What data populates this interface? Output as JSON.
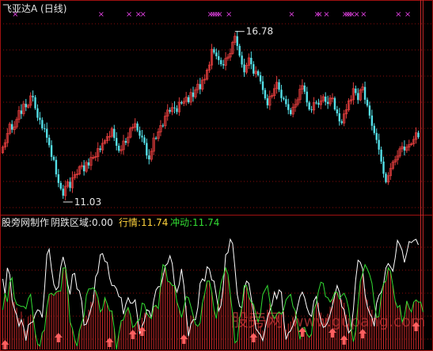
{
  "header": {
    "title": "飞亚达A (日线)",
    "high_label": "16.78",
    "low_label": "11.03"
  },
  "indicator_bar": {
    "maker": "股旁网制作",
    "yin_label": "阴跌区域:0.00",
    "hang_label": "行情:11.74",
    "chong_label": "冲动:11.74"
  },
  "watermark": {
    "cn": "股旁网",
    "en": "www.gupang.com"
  },
  "colors": {
    "background": "#000000",
    "up_candle": "#e03c3c",
    "down_candle": "#54e0e8",
    "grid": "#8a0b0b",
    "frame": "#a01010",
    "indicator_white": "#ffffff",
    "indicator_green": "#33dd33",
    "histogram": "#cc2b2b",
    "signal_arrow": "#ff6060",
    "marker": "#e040e0",
    "label_yellow": "#ffd23c",
    "label_green": "#33dd33"
  },
  "chart_data": [
    {
      "type": "candlestick",
      "title": "飞亚达A (日线)",
      "x": [
        1,
        2,
        3,
        4,
        5,
        6,
        7,
        8,
        9,
        10,
        11,
        12,
        13,
        14,
        15,
        16,
        17,
        18,
        19,
        20,
        21,
        22,
        23,
        24,
        25,
        26,
        27,
        28,
        29,
        30,
        31,
        32,
        33,
        34,
        35,
        36,
        37,
        38,
        39,
        40,
        41,
        42,
        43,
        44,
        45,
        46,
        47,
        48,
        49,
        50,
        51,
        52,
        53,
        54,
        55,
        56,
        57,
        58,
        59,
        60,
        61,
        62,
        63,
        64,
        65,
        66,
        67,
        68,
        69,
        70,
        71,
        72,
        73,
        74,
        75,
        76,
        77,
        78,
        79,
        80,
        81,
        82,
        83,
        84,
        85,
        86,
        87,
        88,
        89,
        90,
        91,
        92,
        93,
        94,
        95,
        96,
        97,
        98,
        99,
        100,
        101,
        102,
        103,
        104,
        105,
        106,
        107,
        108,
        109,
        110,
        111,
        112,
        113,
        114,
        115,
        116,
        117,
        118,
        119,
        120,
        121,
        122,
        123,
        124,
        125,
        126,
        127,
        128,
        129,
        130,
        131,
        132,
        133,
        134,
        135,
        136,
        137,
        138,
        139,
        140,
        141,
        142,
        143,
        144,
        145,
        146,
        147,
        148,
        149,
        150,
        151,
        152,
        153,
        154,
        155,
        156,
        157,
        158,
        159,
        160,
        161,
        162,
        163,
        164,
        165,
        166,
        167,
        168,
        169,
        170,
        171,
        172,
        173,
        174,
        175,
        176,
        177,
        178,
        179,
        180
      ],
      "close": [
        12.78,
        12.94,
        13.27,
        13.61,
        13.41,
        13.51,
        13.78,
        14.1,
        13.98,
        14.34,
        14.22,
        14.29,
        14.63,
        14.58,
        14.18,
        13.84,
        13.76,
        13.46,
        13.44,
        13.12,
        12.85,
        12.43,
        12.32,
        11.8,
        11.49,
        11.28,
        11.03,
        11.37,
        11.53,
        11.31,
        11.68,
        11.79,
        11.81,
        12.07,
        12.12,
        11.91,
        12.23,
        12.12,
        12.41,
        12.41,
        12.44,
        12.73,
        12.68,
        12.92,
        13.01,
        13.16,
        13.17,
        13.44,
        13.11,
        12.83,
        12.65,
        12.69,
        13.0,
        12.94,
        13.14,
        13.46,
        13.5,
        13.63,
        13.38,
        13.19,
        13.13,
        12.93,
        12.48,
        12.34,
        12.63,
        13.11,
        13.09,
        13.33,
        13.56,
        13.55,
        13.9,
        14.12,
        14.06,
        14.21,
        14.18,
        14.05,
        14.4,
        14.36,
        14.43,
        14.58,
        14.4,
        14.75,
        14.59,
        14.85,
        15.05,
        14.87,
        15.2,
        15.23,
        15.56,
        15.74,
        16.31,
        16.19,
        16.06,
        15.92,
        15.77,
        15.73,
        15.98,
        16.03,
        16.16,
        16.56,
        16.78,
        16.43,
        16.08,
        15.76,
        15.48,
        15.73,
        16.0,
        15.77,
        15.43,
        15.52,
        15.37,
        15.15,
        14.84,
        14.54,
        14.29,
        14.61,
        14.64,
        14.89,
        15.12,
        14.85,
        14.55,
        14.51,
        14.33,
        14.12,
        13.97,
        14.22,
        14.32,
        14.49,
        14.87,
        15.0,
        14.78,
        14.39,
        14.14,
        14.12,
        14.39,
        14.38,
        14.31,
        14.45,
        14.6,
        14.41,
        14.34,
        14.55,
        14.55,
        14.14,
        14.0,
        13.71,
        13.65,
        13.98,
        14.13,
        14.45,
        14.49,
        14.89,
        14.73,
        14.48,
        14.84,
        14.95,
        14.49,
        14.28,
        13.92,
        13.55,
        13.29,
        13.04,
        12.69,
        12.26,
        11.82,
        11.52,
        11.75,
        12.01,
        12.24,
        12.32,
        12.46,
        12.72,
        12.8,
        12.66,
        12.78,
        12.87,
        12.9,
        13.06,
        13.3,
        13.14
      ],
      "ylim": [
        10.6,
        17.4
      ],
      "annotations": [
        {
          "text": "16.78",
          "x": 101,
          "y": 16.78
        },
        {
          "text": "11.03",
          "x": 27,
          "y": 11.03
        }
      ],
      "marker_x": [
        6,
        43,
        55,
        59,
        61,
        90,
        91,
        92,
        93,
        94,
        98,
        125,
        136,
        137,
        140,
        148,
        149,
        150,
        151,
        153,
        156,
        171,
        175
      ],
      "grid": true,
      "legend": "none"
    },
    {
      "type": "line",
      "title": "",
      "series": [
        {
          "name": "行情",
          "color": "#ffffff",
          "values": [
            0.64,
            0.5,
            0.74,
            0.68,
            0.45,
            0.37,
            0.31,
            0.21,
            0.27,
            0.2,
            0.08,
            0.22,
            0.24,
            0.25,
            0.32,
            0.36,
            0.35,
            0.29,
            0.55,
            0.86,
            0.91,
            0.73,
            0.59,
            0.54,
            0.57,
            0.75,
            0.84,
            0.75,
            0.59,
            0.5,
            0.68,
            0.69,
            0.55,
            0.53,
            0.44,
            0.22,
            0.23,
            0.29,
            0.37,
            0.44,
            0.66,
            0.7,
            0.86,
            0.87,
            0.8,
            0.79,
            0.65,
            0.58,
            0.58,
            0.55,
            0.48,
            0.47,
            0.32,
            0.41,
            0.47,
            0.42,
            0.42,
            0.45,
            0.3,
            0.14,
            0.21,
            0.26,
            0.36,
            0.35,
            0.29,
            0.44,
            0.54,
            0.57,
            0.57,
            0.66,
            0.76,
            0.78,
            0.85,
            0.78,
            0.59,
            0.52,
            0.59,
            0.73,
            0.58,
            0.33,
            0.12,
            0.23,
            0.27,
            0.27,
            0.38,
            0.6,
            0.64,
            0.62,
            0.75,
            0.73,
            0.63,
            0.62,
            0.49,
            0.35,
            0.4,
            0.58,
            0.86,
            0.88,
            1.0,
            0.96,
            0.74,
            0.5,
            0.39,
            0.38,
            0.55,
            0.62,
            0.6,
            0.47,
            0.34,
            0.19,
            0.16,
            0.13,
            0.08,
            0.19,
            0.29,
            0.35,
            0.41,
            0.52,
            0.46,
            0.54,
            0.52,
            0.27,
            0.09,
            0.15,
            0.17,
            0.22,
            0.28,
            0.39,
            0.48,
            0.52,
            0.47,
            0.38,
            0.32,
            0.3,
            0.44,
            0.48,
            0.36,
            0.26,
            0.2,
            0.21,
            0.25,
            0.32,
            0.4,
            0.49,
            0.58,
            0.52,
            0.39,
            0.36,
            0.24,
            0.15,
            0.18,
            0.36,
            0.63,
            0.81,
            0.79,
            0.73,
            0.5,
            0.39,
            0.33,
            0.29,
            0.21,
            0.42,
            0.49,
            0.52,
            0.59,
            0.74,
            0.78,
            0.75,
            0.71,
            0.83,
            0.99,
            0.95,
            0.9,
            0.79,
            0.88,
            0.98,
            0.97,
            0.99,
            1.0,
            0.95
          ]
        },
        {
          "name": "冲动",
          "color": "#33dd33",
          "values": [
            0.36,
            0.51,
            0.43,
            0.61,
            0.65,
            0.47,
            0.41,
            0.4,
            0.39,
            0.39,
            0.37,
            0.46,
            0.5,
            0.32,
            0.15,
            0.05,
            0.03,
            0.15,
            0.18,
            0.38,
            0.5,
            0.51,
            0.49,
            0.52,
            0.53,
            0.53,
            0.74,
            0.74,
            0.54,
            0.25,
            0.19,
            0.09,
            0.03,
            0.17,
            0.24,
            0.3,
            0.49,
            0.55,
            0.55,
            0.56,
            0.53,
            0.47,
            0.34,
            0.37,
            0.47,
            0.41,
            0.35,
            0.35,
            0.19,
            0.0,
            0.14,
            0.26,
            0.27,
            0.34,
            0.38,
            0.31,
            0.2,
            0.22,
            0.26,
            0.27,
            0.42,
            0.41,
            0.33,
            0.3,
            0.28,
            0.39,
            0.4,
            0.37,
            0.59,
            0.77,
            0.75,
            0.62,
            0.61,
            0.58,
            0.58,
            0.43,
            0.37,
            0.29,
            0.38,
            0.48,
            0.47,
            0.39,
            0.31,
            0.23,
            0.21,
            0.24,
            0.42,
            0.51,
            0.62,
            0.62,
            0.52,
            0.36,
            0.28,
            0.46,
            0.6,
            0.67,
            0.74,
            0.68,
            0.5,
            0.32,
            0.06,
            0.08,
            0.28,
            0.39,
            0.58,
            0.58,
            0.48,
            0.43,
            0.41,
            0.32,
            0.25,
            0.33,
            0.5,
            0.54,
            0.58,
            0.44,
            0.32,
            0.28,
            0.32,
            0.34,
            0.32,
            0.36,
            0.45,
            0.48,
            0.5,
            0.39,
            0.35,
            0.22,
            0.09,
            0.19,
            0.2,
            0.14,
            0.11,
            0.14,
            0.36,
            0.42,
            0.53,
            0.61,
            0.6,
            0.48,
            0.47,
            0.43,
            0.46,
            0.52,
            0.52,
            0.46,
            0.49,
            0.51,
            0.46,
            0.37,
            0.2,
            0.07,
            0.17,
            0.41,
            0.62,
            0.69,
            0.77,
            0.73,
            0.68,
            0.6,
            0.42,
            0.29,
            0.3,
            0.49,
            0.6,
            0.62,
            0.74,
            0.71,
            0.58,
            0.44,
            0.38,
            0.4,
            0.25,
            0.3,
            0.44,
            0.38,
            0.34,
            0.43,
            0.45,
            0.43,
            0.43,
            0.34
          ]
        }
      ],
      "signal_arrows_x": [
        2,
        25,
        47,
        57,
        61,
        79,
        109,
        130,
        143,
        148,
        156,
        179
      ],
      "grid": true,
      "legend": "top-left"
    }
  ]
}
